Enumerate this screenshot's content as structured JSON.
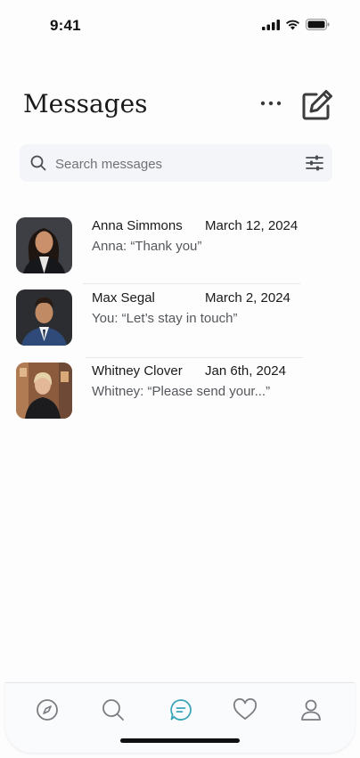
{
  "status_bar": {
    "time": "9:41"
  },
  "header": {
    "title": "Messages"
  },
  "search": {
    "placeholder": "Search messages"
  },
  "conversations": [
    {
      "name": "Anna Simmons",
      "date": "March 12, 2024",
      "preview": "Anna:  “Thank you”"
    },
    {
      "name": "Max Segal",
      "date": "March 2, 2024",
      "preview": "You:  “Let’s stay in touch”"
    },
    {
      "name": "Whitney Clover",
      "date": "Jan 6th, 2024",
      "preview": "Whitney:  “Please send your...”"
    }
  ],
  "tab_bar": {
    "tabs": [
      {
        "icon": "compass-icon",
        "active": false
      },
      {
        "icon": "search-icon",
        "active": false
      },
      {
        "icon": "chat-icon",
        "active": true
      },
      {
        "icon": "heart-icon",
        "active": false
      },
      {
        "icon": "profile-icon",
        "active": false
      }
    ]
  },
  "colors": {
    "accent": "#3aa6b9",
    "icon_gray": "#7a7d82",
    "text": "#1a1a1a"
  }
}
